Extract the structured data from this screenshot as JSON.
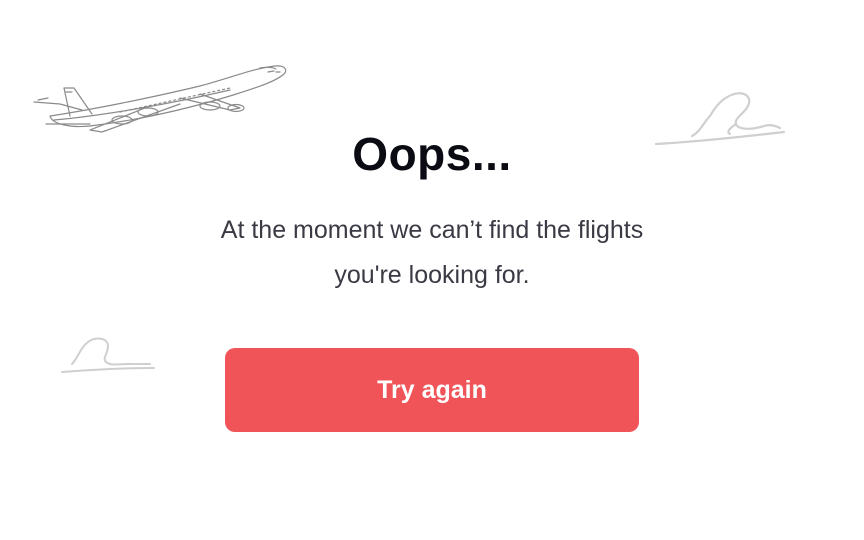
{
  "error": {
    "title": "Oops...",
    "message": "At the moment we can’t find the flights you're looking for.",
    "retry_button_label": "Try again"
  },
  "colors": {
    "button_background": "#f05458",
    "title_text": "#0b0b14",
    "body_text": "#3a3a44",
    "illustration_stroke": "#8a8a8a"
  },
  "icons": [
    "airplane-illustration-icon",
    "cloud-sketch-icon"
  ]
}
